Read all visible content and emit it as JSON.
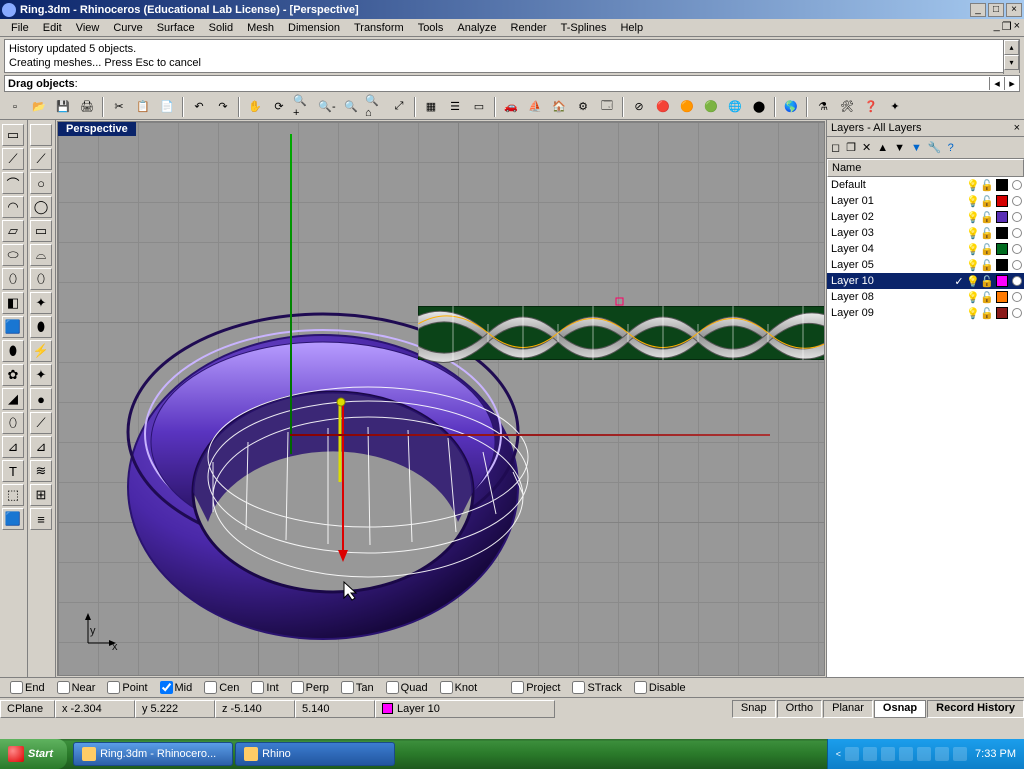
{
  "title": "Ring.3dm - Rhinoceros (Educational Lab License) - [Perspective]",
  "menu": [
    "File",
    "Edit",
    "View",
    "Curve",
    "Surface",
    "Solid",
    "Mesh",
    "Dimension",
    "Transform",
    "Tools",
    "Analyze",
    "Render",
    "T-Splines",
    "Help"
  ],
  "command_history": [
    "History updated 5 objects.",
    "Creating meshes... Press Esc to cancel"
  ],
  "command_prompt_label": "Drag objects",
  "viewport_label": "Perspective",
  "layers_panel": {
    "title": "Layers - All Layers",
    "header": "Name",
    "rows": [
      {
        "name": "Default",
        "color": "#000000",
        "selected": false,
        "checked": false
      },
      {
        "name": "Layer 01",
        "color": "#d40000",
        "selected": false,
        "checked": false
      },
      {
        "name": "Layer 02",
        "color": "#5a2fb5",
        "selected": false,
        "checked": false
      },
      {
        "name": "Layer 03",
        "color": "#000000",
        "selected": false,
        "checked": false
      },
      {
        "name": "Layer 04",
        "color": "#006b1f",
        "selected": false,
        "checked": false
      },
      {
        "name": "Layer 05",
        "color": "#000000",
        "selected": false,
        "checked": false
      },
      {
        "name": "Layer 10",
        "color": "#ff00ff",
        "selected": true,
        "checked": true,
        "dotfill": "#fff"
      },
      {
        "name": "Layer 08",
        "color": "#ff7a00",
        "selected": false,
        "checked": false
      },
      {
        "name": "Layer 09",
        "color": "#8a1a1a",
        "selected": false,
        "checked": false
      }
    ]
  },
  "osnap": {
    "items": [
      {
        "label": "End",
        "on": false
      },
      {
        "label": "Near",
        "on": false
      },
      {
        "label": "Point",
        "on": false
      },
      {
        "label": "Mid",
        "on": true
      },
      {
        "label": "Cen",
        "on": false
      },
      {
        "label": "Int",
        "on": false
      },
      {
        "label": "Perp",
        "on": false
      },
      {
        "label": "Tan",
        "on": false
      },
      {
        "label": "Quad",
        "on": false
      },
      {
        "label": "Knot",
        "on": false
      }
    ],
    "extras": [
      {
        "label": "Project",
        "on": false
      },
      {
        "label": "STrack",
        "on": false
      },
      {
        "label": "Disable",
        "on": false
      }
    ]
  },
  "status": {
    "cplane": "CPlane",
    "x": "x -2.304",
    "y": "y 5.222",
    "z": "z -5.140",
    "w": "5.140",
    "layer": "Layer 10",
    "panes": [
      {
        "label": "Snap",
        "active": false
      },
      {
        "label": "Ortho",
        "active": false
      },
      {
        "label": "Planar",
        "active": false
      },
      {
        "label": "Osnap",
        "active": true,
        "bold": true
      },
      {
        "label": "Record History",
        "active": false,
        "bold": true
      }
    ]
  },
  "taskbar": {
    "start": "Start",
    "tasks": [
      {
        "label": "Ring.3dm - Rhinocero...",
        "active": true
      },
      {
        "label": "Rhino",
        "active": false
      }
    ],
    "clock": "7:33 PM"
  },
  "axis": {
    "x": "x",
    "y": "y"
  }
}
